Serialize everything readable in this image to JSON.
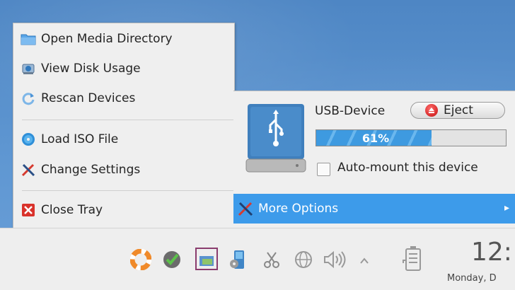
{
  "menu": {
    "items": [
      {
        "label": "Open Media Directory",
        "icon": "folder-icon"
      },
      {
        "label": "View Disk Usage",
        "icon": "disk-usage-icon"
      },
      {
        "label": "Rescan Devices",
        "icon": "refresh-icon"
      },
      {
        "label": "Load ISO File",
        "icon": "disc-icon"
      },
      {
        "label": "Change Settings",
        "icon": "settings-tools-icon"
      },
      {
        "label": "Close Tray",
        "icon": "close-icon"
      }
    ]
  },
  "device": {
    "name": "USB-Device",
    "eject_label": "Eject",
    "progress_text": "61%",
    "progress_value": 61,
    "automount_label": "Auto-mount this device",
    "automount_checked": false,
    "more_options_label": "More Options"
  },
  "taskbar": {
    "clock_time": "12:",
    "clock_date": "Monday, D"
  },
  "colors": {
    "highlight": "#3d9bea",
    "progress": "#3e9ae0",
    "desktop": "#5a92cf",
    "close": "#d9322b"
  }
}
